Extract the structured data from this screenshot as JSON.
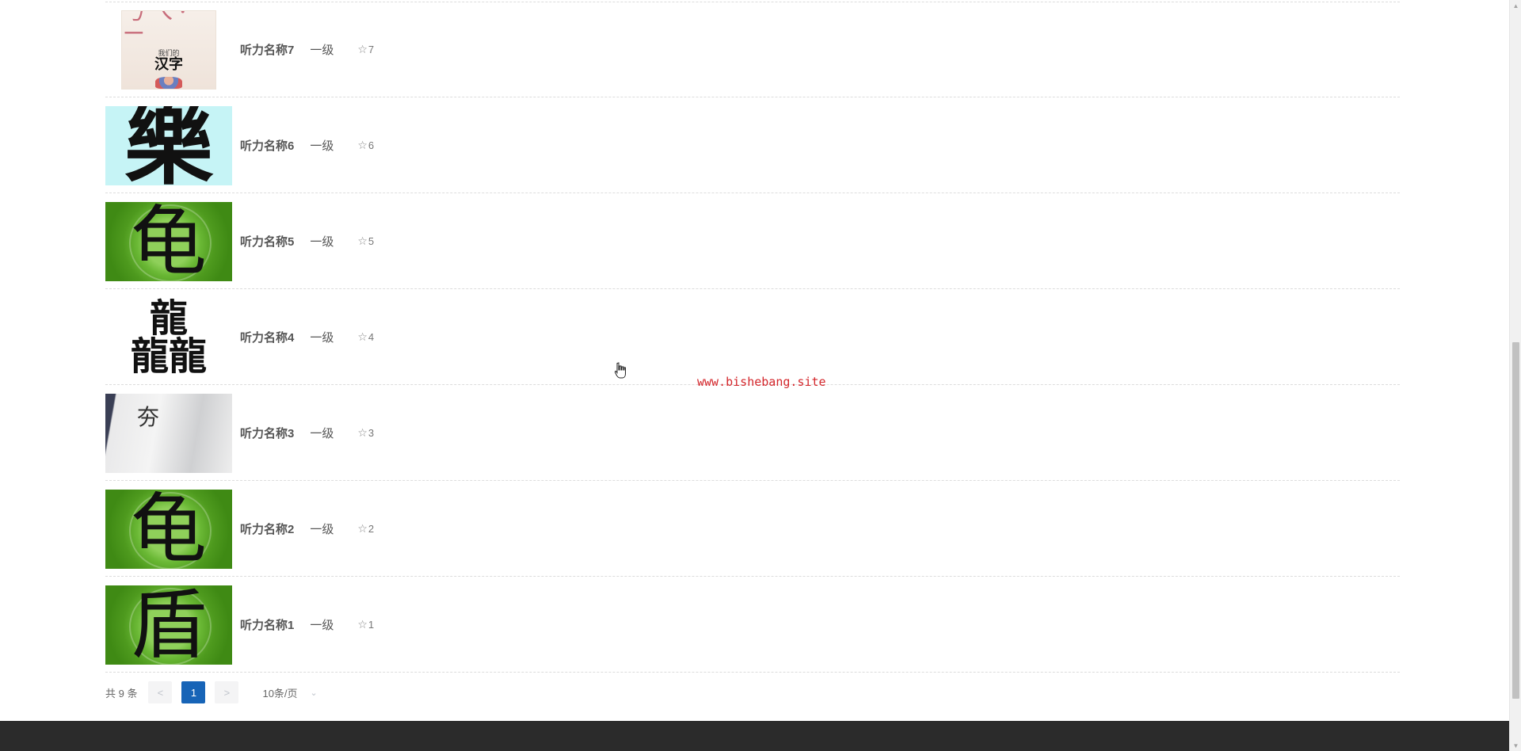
{
  "items": [
    {
      "name": "听力名称7",
      "level": "一级",
      "stars": "7",
      "thumb_style": "book",
      "thumb_text": {
        "top": "ㄋㄟ·ㄧ",
        "small": "我们的",
        "title": "汉字"
      }
    },
    {
      "name": "听力名称6",
      "level": "一级",
      "stars": "6",
      "thumb_style": "cyan",
      "thumb_text": {
        "glyph": "樂"
      }
    },
    {
      "name": "听力名称5",
      "level": "一级",
      "stars": "5",
      "thumb_style": "green",
      "thumb_text": {
        "glyph": "龟"
      }
    },
    {
      "name": "听力名称4",
      "level": "一级",
      "stars": "4",
      "thumb_style": "white",
      "thumb_text": {
        "line1": "龍",
        "line2": "龍龍"
      }
    },
    {
      "name": "听力名称3",
      "level": "一级",
      "stars": "3",
      "thumb_style": "paper",
      "thumb_text": {
        "glyph": "夯"
      }
    },
    {
      "name": "听力名称2",
      "level": "一级",
      "stars": "2",
      "thumb_style": "green",
      "thumb_text": {
        "glyph": "龟"
      }
    },
    {
      "name": "听力名称1",
      "level": "一级",
      "stars": "1",
      "thumb_style": "green",
      "thumb_text": {
        "glyph": "盾"
      }
    }
  ],
  "watermark": "www.bishebang.site",
  "pagination": {
    "total_text": "共 9 条",
    "prev": "<",
    "current_page": "1",
    "next": ">",
    "page_size": "10条/页",
    "page_size_chevron": "⌄"
  },
  "icons": {
    "star": "☆",
    "scroll_up": "▲",
    "scroll_down": "▼"
  },
  "colors": {
    "page_bg": "#ffffff",
    "text": "#555555",
    "active_page": "#1764b7",
    "watermark": "#d4262b",
    "footer": "#2b2b2b"
  }
}
